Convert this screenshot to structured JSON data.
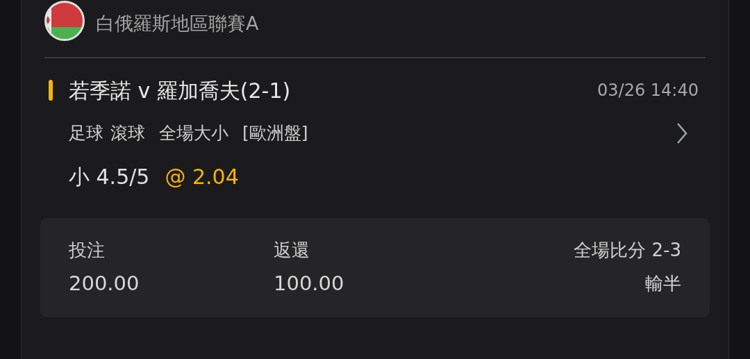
{
  "league": {
    "name": "白俄羅斯地區聯賽A"
  },
  "match": {
    "teams": "若季諾 v 羅加喬夫(2-1)",
    "time": "03/26 14:40",
    "details": [
      "足球",
      "滾球",
      "全場大小",
      "[歐洲盤]"
    ],
    "selection": "小 4.5/5",
    "odds": "@ 2.04"
  },
  "summary": [
    {
      "label": "投注",
      "value": "200.00"
    },
    {
      "label": "返還",
      "value": "100.00"
    },
    {
      "label": "全場比分 2-3",
      "value": "輸半"
    }
  ]
}
